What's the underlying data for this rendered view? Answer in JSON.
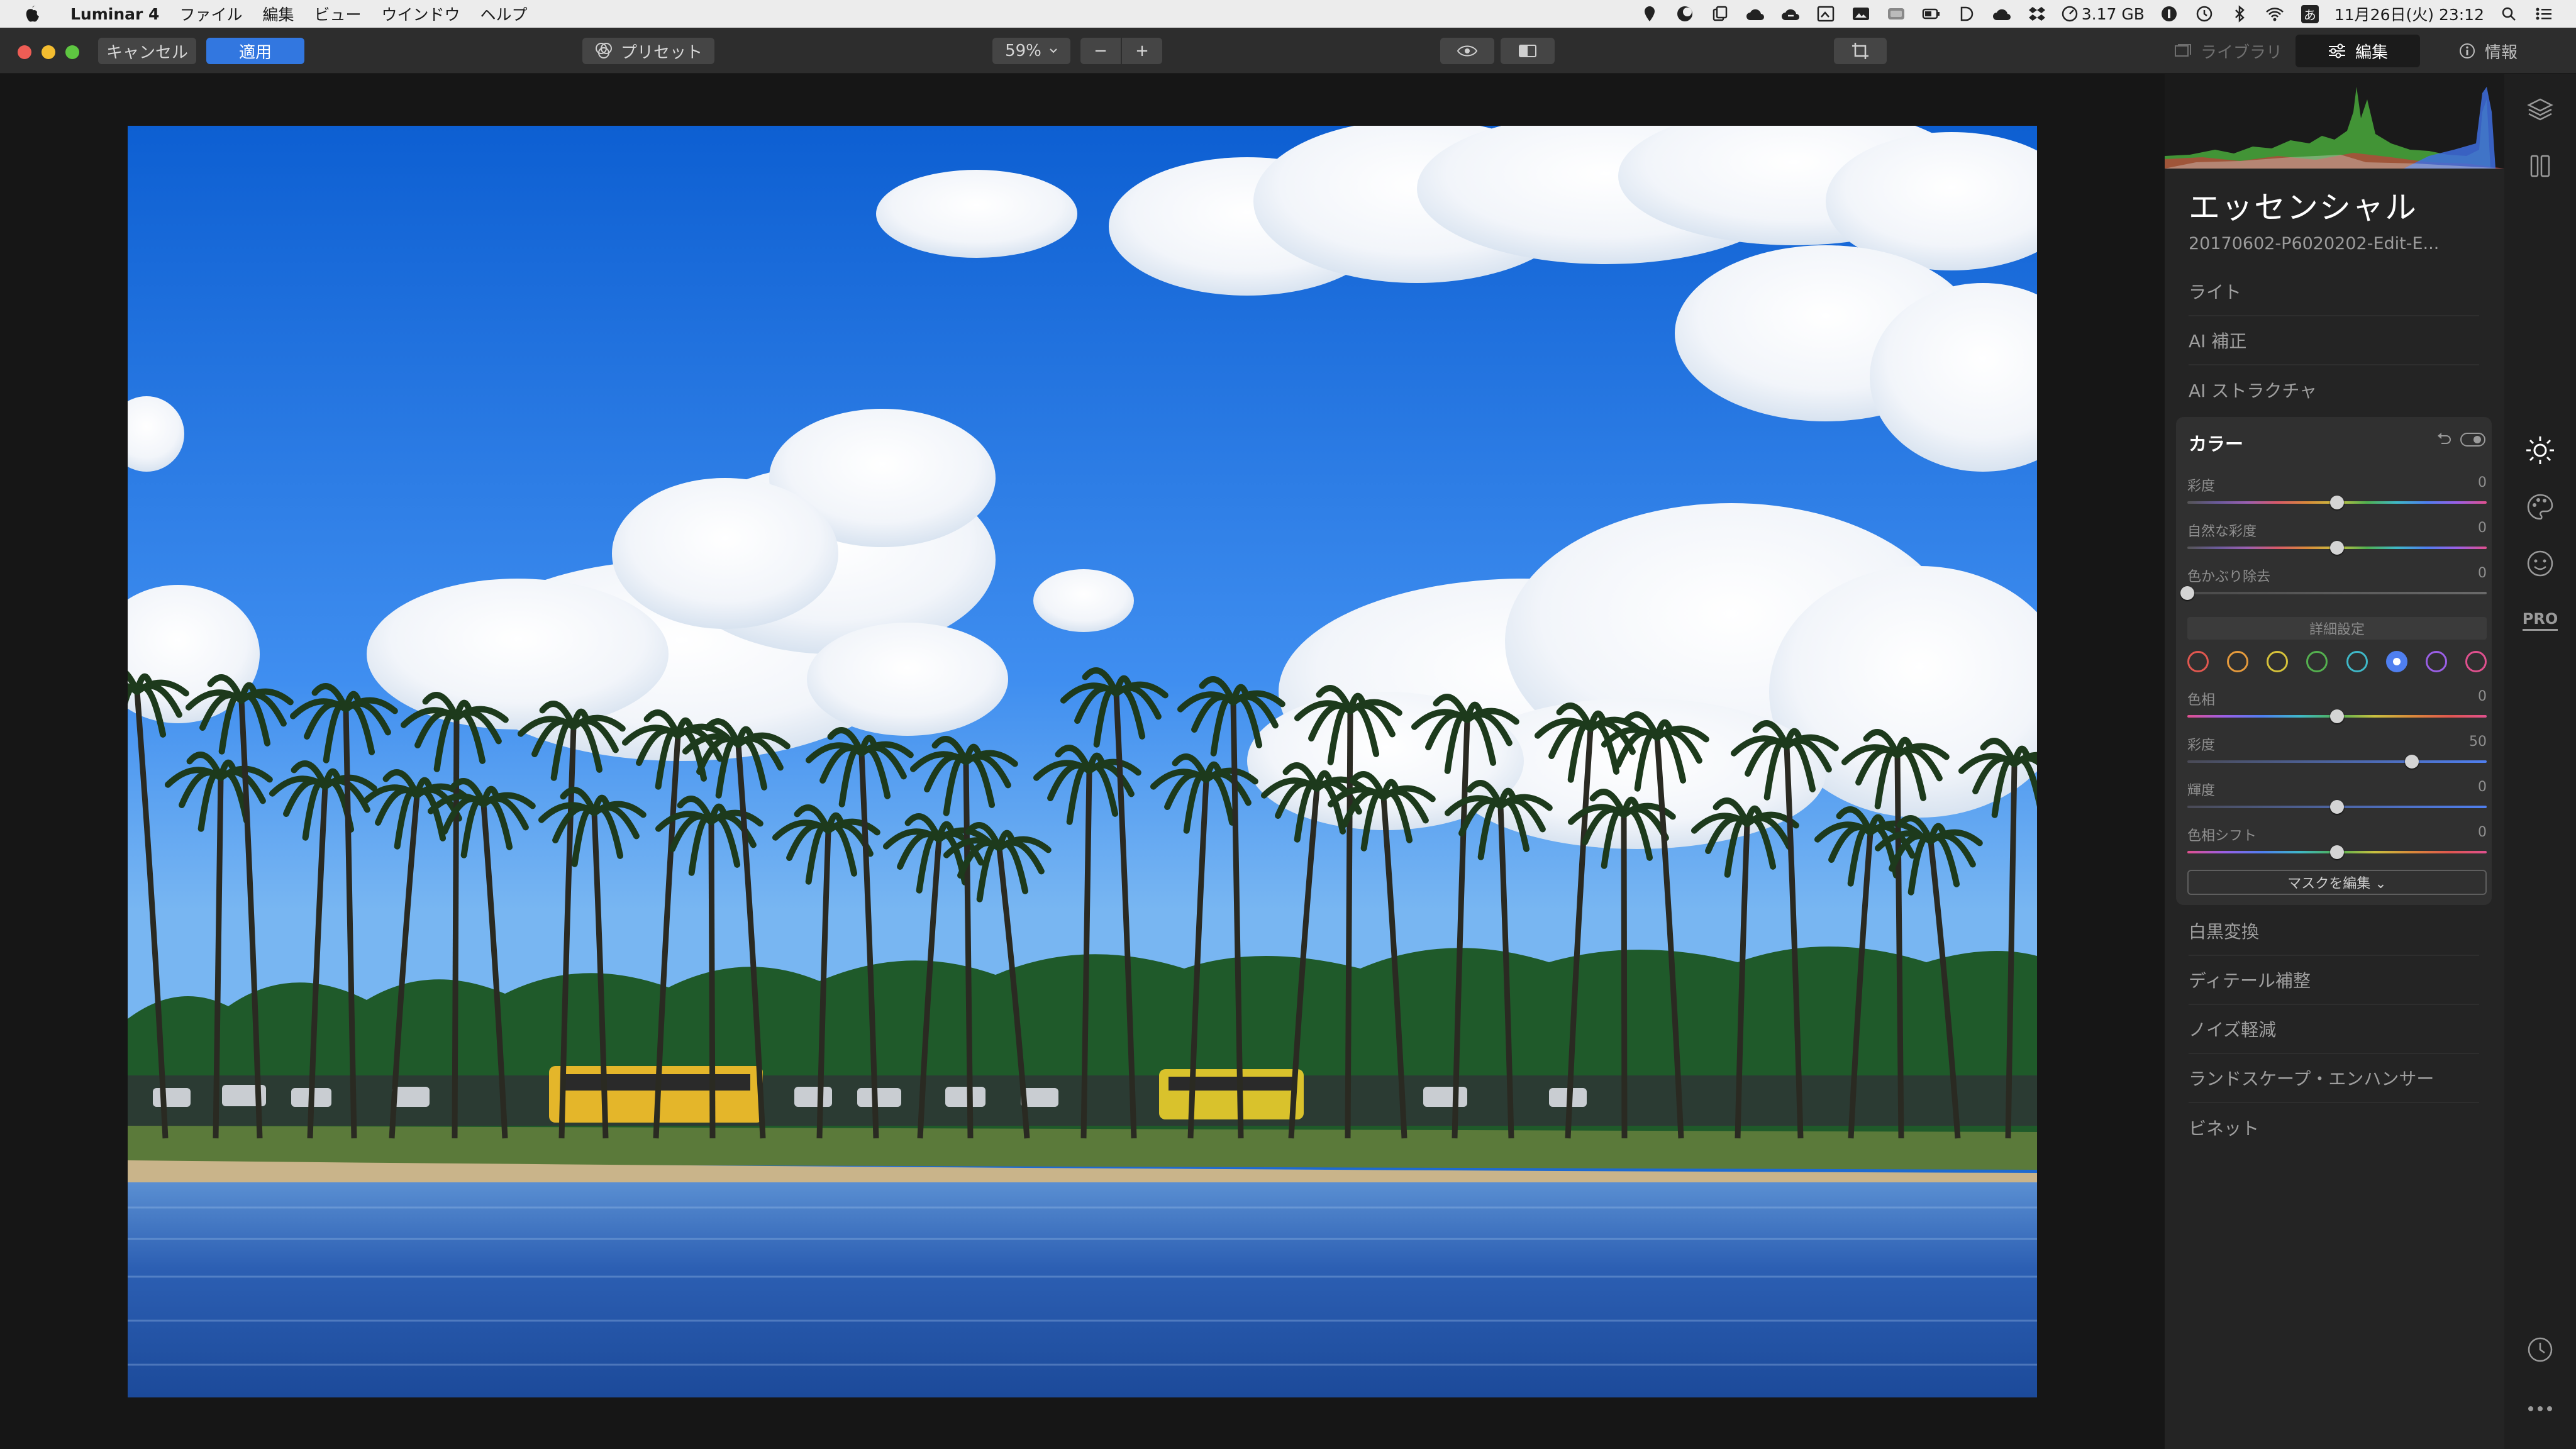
{
  "menubar": {
    "app_name": "Luminar 4",
    "menus": [
      "ファイル",
      "編集",
      "ビュー",
      "ウインドウ",
      "ヘルプ"
    ],
    "memory": "3.17 GB",
    "ime": "あ",
    "datetime": "11月26日(火) 23:12"
  },
  "toolbar": {
    "cancel_label": "キャンセル",
    "apply_label": "適用",
    "presets_label": "プリセット",
    "zoom": "59%",
    "zoom_out": "−",
    "zoom_in": "+",
    "tabs": [
      {
        "label": "ライブラリ",
        "icon": "library-icon",
        "active": false
      },
      {
        "label": "編集",
        "icon": "sliders-icon",
        "active": true
      },
      {
        "label": "情報",
        "icon": "info-icon",
        "active": false
      }
    ]
  },
  "panel": {
    "title": "エッセンシャル",
    "filename": "20170602-P6020202-Edit-E...",
    "sections_above": [
      "ライト",
      "AI 補正",
      "AI ストラクチャ"
    ],
    "color": {
      "title": "カラー",
      "sliders": [
        {
          "label": "彩度",
          "value": "0",
          "pos": 0.5,
          "gradient": "sat"
        },
        {
          "label": "自然な彩度",
          "value": "0",
          "pos": 0.5,
          "gradient": "sat"
        },
        {
          "label": "色かぶり除去",
          "value": "0",
          "pos": 0.0,
          "gradient": "gray"
        }
      ],
      "advanced_label": "詳細設定",
      "swatches": [
        "#e0574f",
        "#e59a3c",
        "#d6c23a",
        "#54b04f",
        "#3fb8c8",
        "#4f7ff0",
        "#9a5fe6",
        "#e0508e"
      ],
      "active_swatch": 5,
      "adv_sliders": [
        {
          "label": "色相",
          "value": "0",
          "pos": 0.5,
          "gradient": "hue"
        },
        {
          "label": "彩度",
          "value": "50",
          "pos": 0.75,
          "gradient": "blue"
        },
        {
          "label": "輝度",
          "value": "0",
          "pos": 0.5,
          "gradient": "blue"
        },
        {
          "label": "色相シフト",
          "value": "0",
          "pos": 0.5,
          "gradient": "hue"
        }
      ],
      "mask_label": "マスクを編集 ⌄"
    },
    "sections_below": [
      "白黒変換",
      "ディテール補整",
      "ノイズ軽減",
      "ランドスケープ・エンハンサー",
      "ビネット"
    ]
  },
  "strip": {
    "icons": [
      "layers-icon",
      "canvas-icon",
      "essentials-sun-icon",
      "creative-palette-icon",
      "portrait-face-icon",
      "pro-icon",
      "history-clock-icon",
      "more-icon"
    ],
    "pro_label": "PRO"
  }
}
